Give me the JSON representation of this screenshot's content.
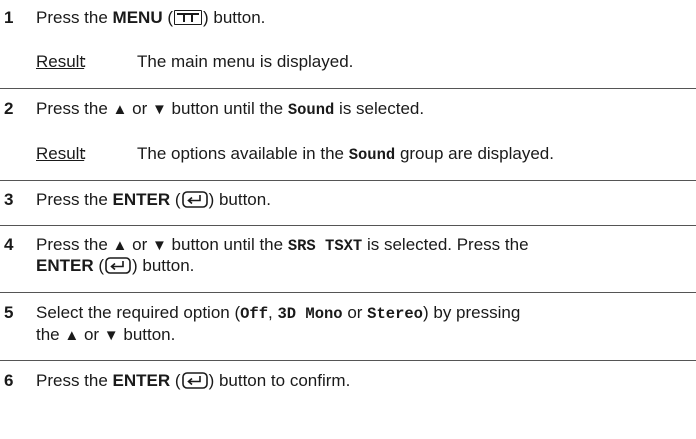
{
  "steps": [
    {
      "number": "1",
      "text_a": "Press the ",
      "bold_a": "MENU",
      "text_b": " (",
      "icon": "menu-button-icon",
      "text_c": ") button.",
      "result_label": "Result",
      "result_colon": ":",
      "result_text": "The main menu is displayed."
    },
    {
      "number": "2",
      "text_a": "Press the ",
      "up_symbol": "▲",
      "text_b": " or ",
      "down_symbol": "▼",
      "text_c": " button until the ",
      "mono_a": "Sound",
      "text_d": " is selected.",
      "result_label": "Result",
      "result_colon": ":",
      "result_text_a": "The options available in the ",
      "result_mono": "Sound",
      "result_text_b": " group are displayed."
    },
    {
      "number": "3",
      "text_a": "Press the ",
      "bold_a": "ENTER",
      "text_b": " (",
      "icon": "enter-button-icon",
      "text_c": ") button."
    },
    {
      "number": "4",
      "text_a": "Press the ",
      "up_symbol": "▲",
      "text_b": " or ",
      "down_symbol": "▼",
      "text_c": " button until the ",
      "mono_a": "SRS TSXT",
      "text_d": " is selected. Press the",
      "bold_b": "ENTER",
      "text_e": " (",
      "icon": "enter-button-icon",
      "text_f": ") button."
    },
    {
      "number": "5",
      "text_a": "Select the required option (",
      "mono_a": "Off",
      "text_b": ", ",
      "mono_b": "3D Mono",
      "text_c": " or ",
      "mono_c": "Stereo",
      "text_d": ") by pressing",
      "text_e": "the ",
      "up_symbol": "▲",
      "text_f": " or ",
      "down_symbol": "▼",
      "text_g": " button."
    },
    {
      "number": "6",
      "text_a": "Press the ",
      "bold_a": "ENTER",
      "text_b": " (",
      "icon": "enter-button-icon",
      "text_c": ") button to confirm."
    }
  ]
}
